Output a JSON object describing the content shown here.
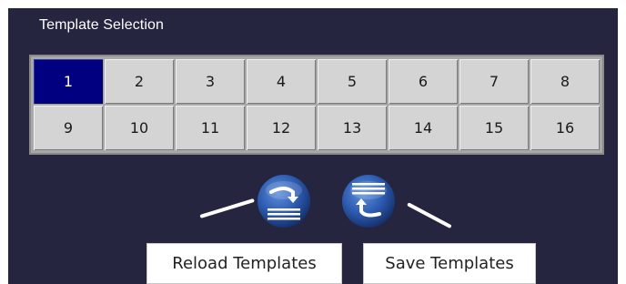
{
  "panel": {
    "title": "Template Selection"
  },
  "templates": {
    "selected": "1",
    "cells": [
      "1",
      "2",
      "3",
      "4",
      "5",
      "6",
      "7",
      "8",
      "9",
      "10",
      "11",
      "12",
      "13",
      "14",
      "15",
      "16"
    ]
  },
  "actions": {
    "reload": {
      "icon": "reload-templates-icon",
      "label": "Reload Templates"
    },
    "save": {
      "icon": "save-templates-icon",
      "label": "Save Templates"
    }
  },
  "colors": {
    "panel_background": "#25253f",
    "cell_background": "#d4d4d4",
    "selected_background": "#000080",
    "icon_blue": "#2b5aa8"
  }
}
